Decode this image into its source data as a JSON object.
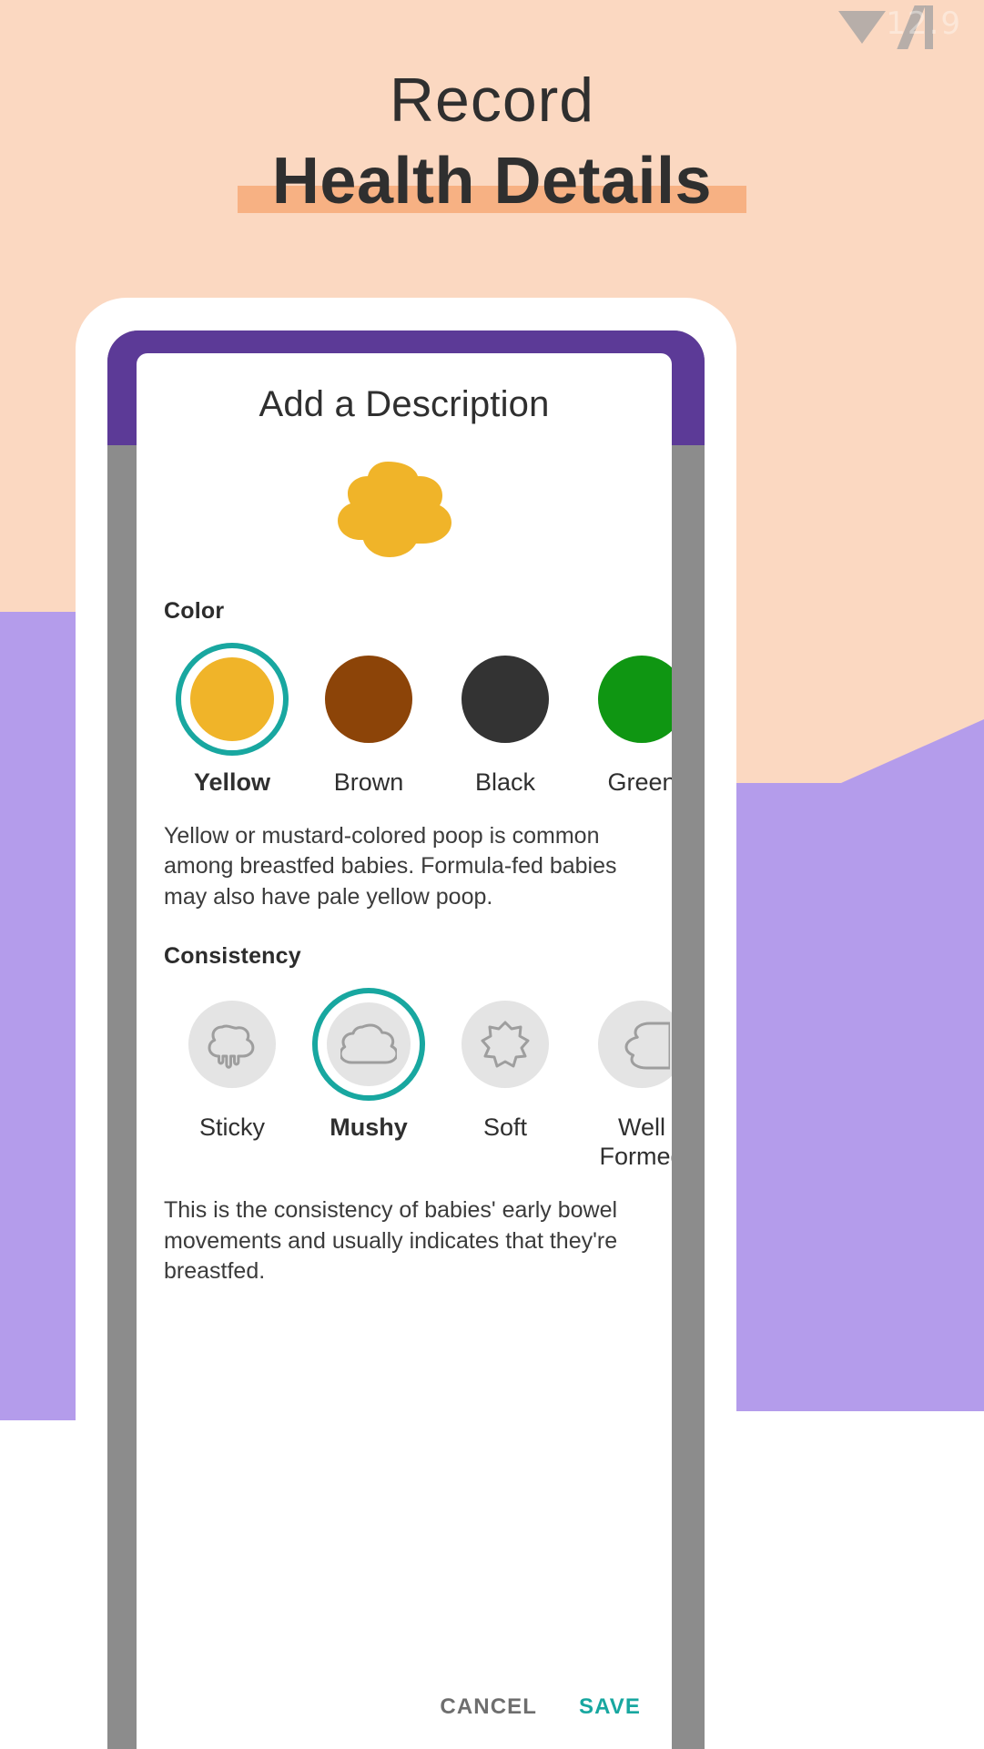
{
  "theme": {
    "bg_peach": "#fbd8c1",
    "bg_purple": "#b49ceb",
    "highlight_bar": "#f7b183",
    "status_bar_purple": "#5c3a97",
    "accent_teal": "#18a7a0",
    "text_dark": "#2f2f2f"
  },
  "headline": {
    "line1": "Record",
    "line2": "Health Details"
  },
  "phone": {
    "watermark": "12.9"
  },
  "dialog": {
    "title": "Add a Description",
    "hero_icon": "poop-cloud-icon",
    "hero_color": "#f0b429",
    "color_section": {
      "heading": "Color",
      "options": [
        {
          "label": "Yellow",
          "color": "#f0b429",
          "selected": true
        },
        {
          "label": "Brown",
          "color": "#8c4408",
          "selected": false
        },
        {
          "label": "Black",
          "color": "#333333",
          "selected": false
        },
        {
          "label": "Green",
          "color": "#0f9612",
          "selected": false
        }
      ],
      "description": "Yellow or mustard-colored poop is common among breastfed babies. Formula-fed babies may also have pale yellow poop."
    },
    "consistency_section": {
      "heading": "Consistency",
      "options": [
        {
          "label": "Sticky",
          "icon": "sticky-drip-icon",
          "selected": false
        },
        {
          "label": "Mushy",
          "icon": "mushy-cloud-icon",
          "selected": true
        },
        {
          "label": "Soft",
          "icon": "soft-star-icon",
          "selected": false
        },
        {
          "label": "Well Formed",
          "icon": "well-formed-icon",
          "selected": false
        }
      ],
      "description": "This is the consistency of babies' early bowel movements and usually indicates that they're breastfed."
    },
    "actions": {
      "cancel": "CANCEL",
      "save": "SAVE"
    }
  }
}
